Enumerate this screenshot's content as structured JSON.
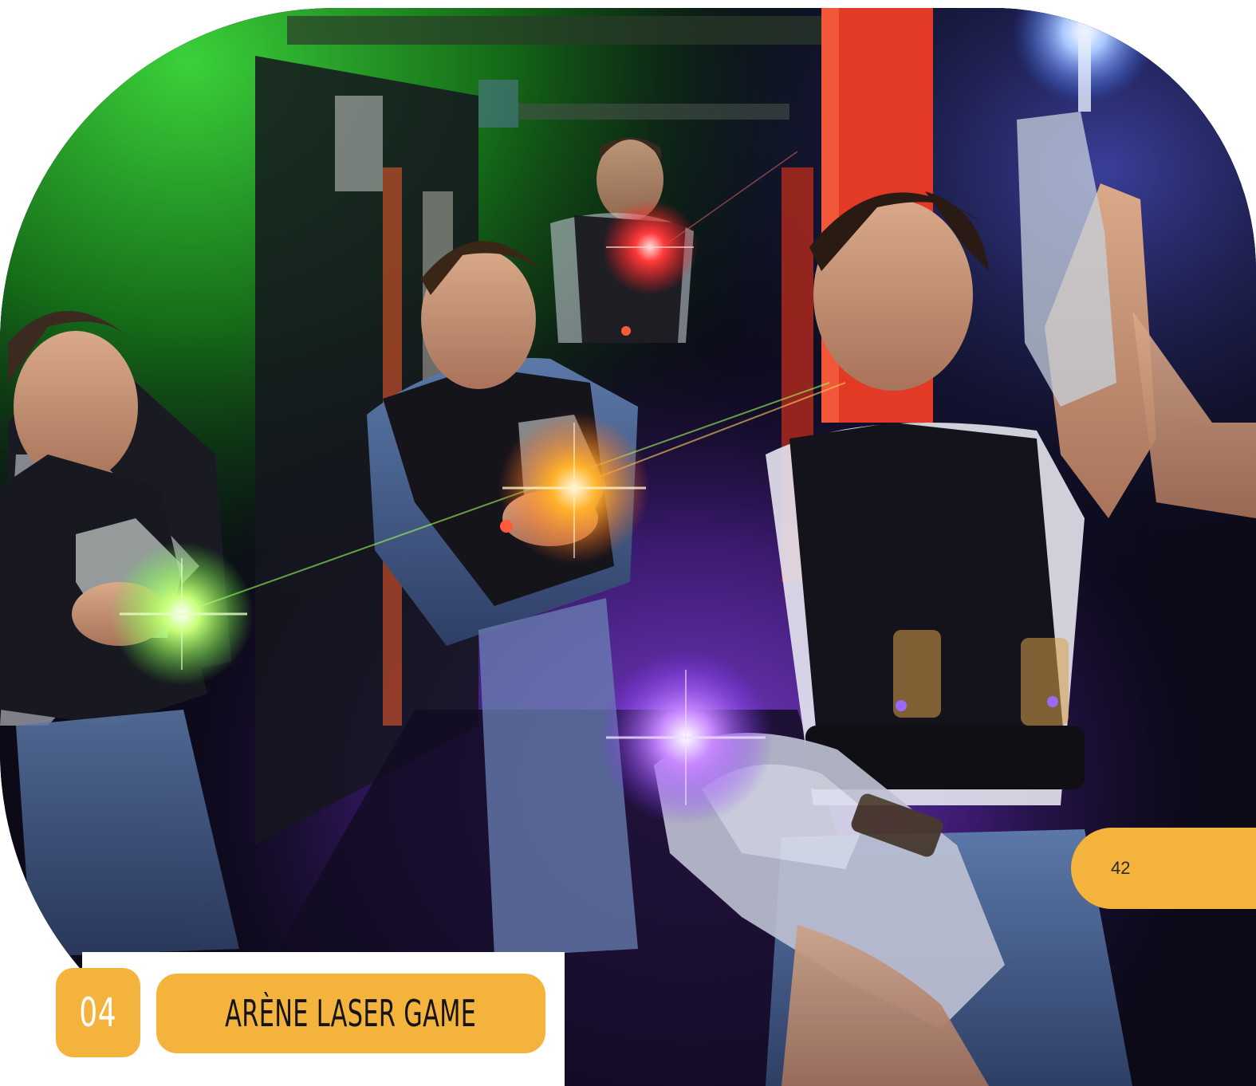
{
  "section": {
    "number": "04",
    "title": "ARÈNE LASER GAME"
  },
  "page": {
    "number": "42"
  },
  "colors": {
    "accent": "#f4b33c",
    "background": "#ffffff"
  }
}
